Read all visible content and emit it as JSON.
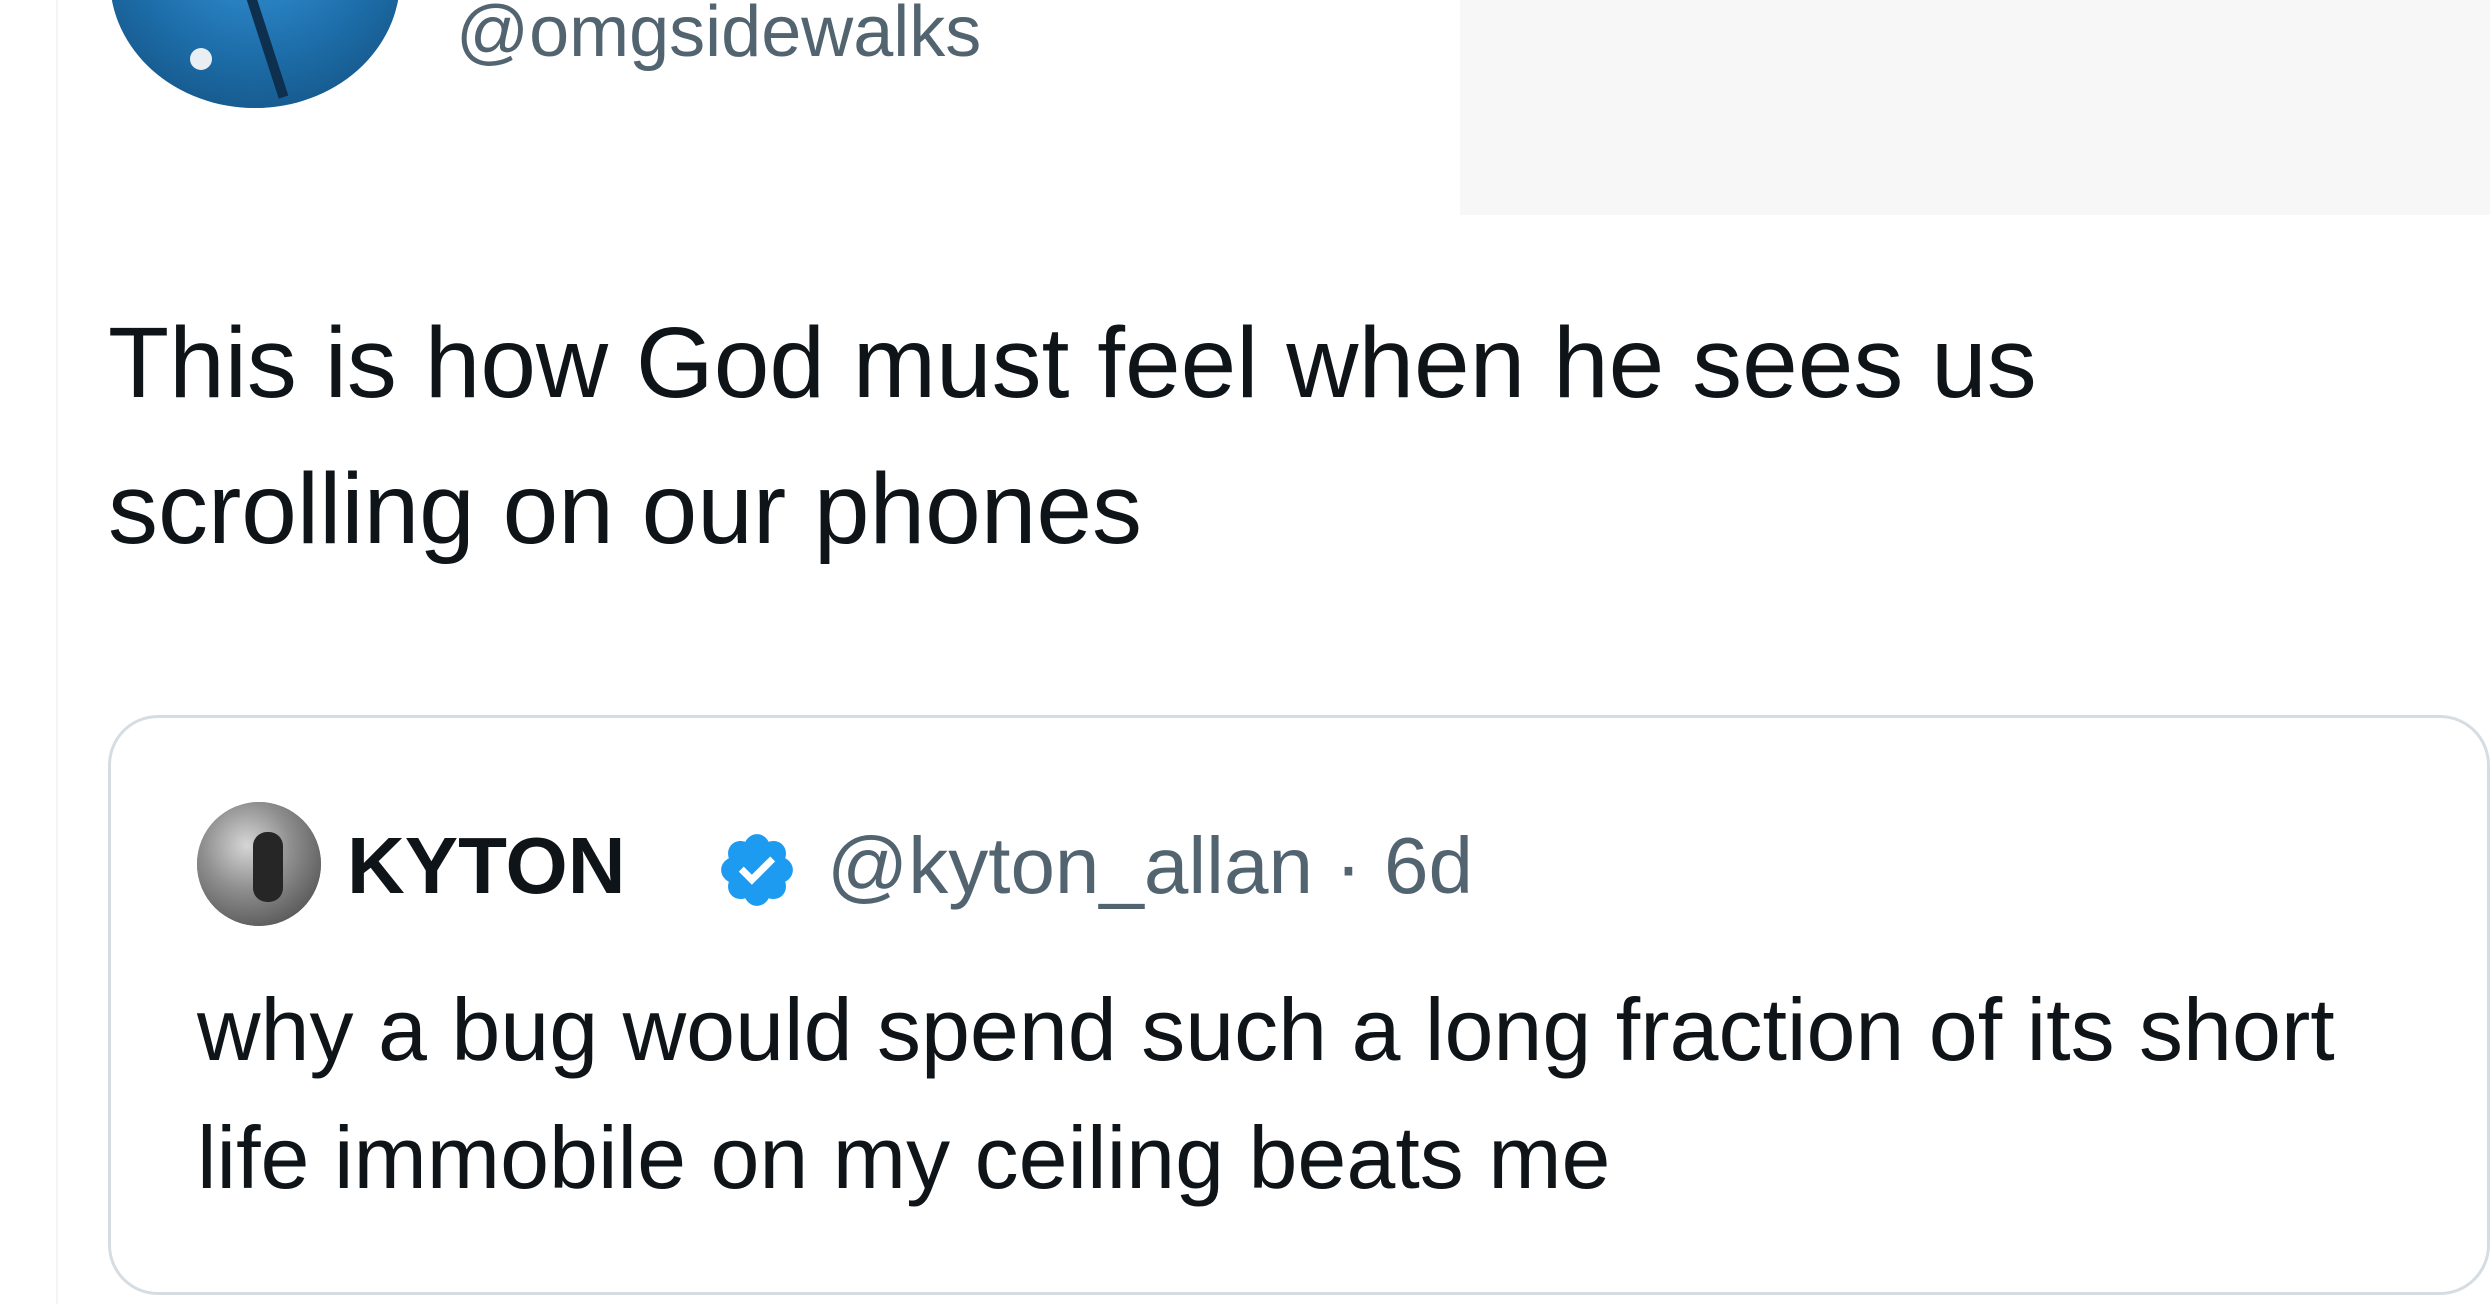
{
  "tweet": {
    "handle": "@omgsidewalks",
    "text": "This is how God must feel when he sees us scrolling on our phones"
  },
  "quoted_tweet": {
    "name": "KYTON",
    "verified_icon": "verified-badge-icon",
    "handle": "@kyton_allan",
    "separator": "·",
    "time": "6d",
    "text": "why a bug would spend such a long fraction of its short life immobile on my ceiling beats me"
  },
  "colors": {
    "text": "#0f1419",
    "secondary_text": "#536471",
    "verified_blue": "#1d9bf0",
    "border": "#d6dde2"
  }
}
